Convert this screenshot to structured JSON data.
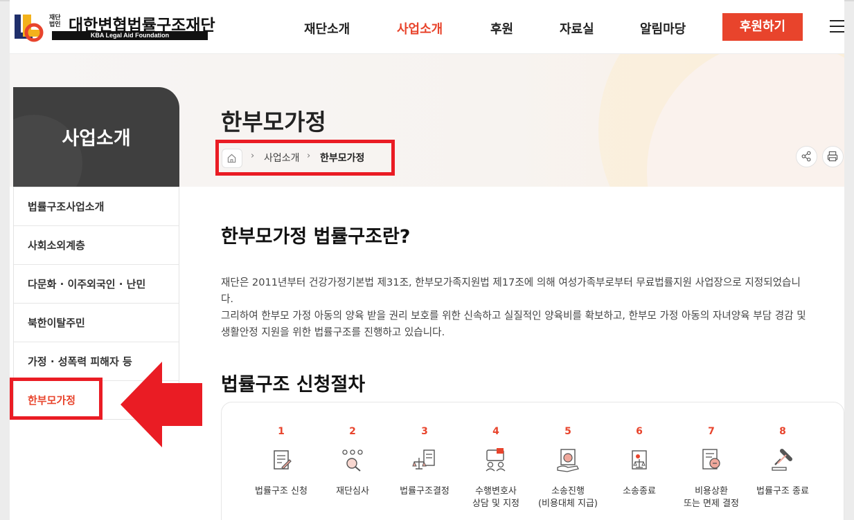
{
  "brand": {
    "sub_label": "재단법인",
    "name": "대한변협법률구조재단",
    "name_en": "KBA Legal Aid Foundation"
  },
  "nav": {
    "items": [
      {
        "label": "재단소개"
      },
      {
        "label": "사업소개",
        "active": true
      },
      {
        "label": "후원"
      },
      {
        "label": "자료실"
      },
      {
        "label": "알림마당"
      }
    ],
    "donate_label": "후원하기"
  },
  "sidebar": {
    "title": "사업소개",
    "items": [
      {
        "label": "법률구조사업소개"
      },
      {
        "label": "사회소외계층"
      },
      {
        "label": "다문화 · 이주외국인 · 난민"
      },
      {
        "label": "북한이탈주민"
      },
      {
        "label": "가정 · 성폭력 피해자 등"
      },
      {
        "label": "한부모가정",
        "active": true
      }
    ]
  },
  "page": {
    "title": "한부모가정",
    "breadcrumb": [
      "사업소개",
      "한부모가정"
    ]
  },
  "content": {
    "section1_title": "한부모가정 법률구조란?",
    "para_lines": [
      "재단은 2011년부터 건강가정기본법 제31조, 한부모가족지원법 제17조에 의해 여성가족부로부터 무료법률지원 사업장으로 지정되었습니",
      "다.",
      "그리하여 한부모 가정 아동의 양육 받을 권리 보호를 위한 신속하고 실질적인 양육비를 확보하고, 한부모 가정 아동의 자녀양육 부담 경감 및",
      "생활안정 지원을 위한 법률구조를 진행하고 있습니다."
    ],
    "section2_title": "법률구조 신청절차"
  },
  "steps": [
    {
      "num": "1",
      "line1": "법률구조 신청",
      "line2": "",
      "icon": "document-pen-icon"
    },
    {
      "num": "2",
      "line1": "재단심사",
      "line2": "",
      "icon": "review-search-icon"
    },
    {
      "num": "3",
      "line1": "법률구조결정",
      "line2": "",
      "icon": "scales-document-icon"
    },
    {
      "num": "4",
      "line1": "수행변호사",
      "line2": "상담 및 지정",
      "icon": "consultation-icon"
    },
    {
      "num": "5",
      "line1": "소송진행",
      "line2": "(비용대체 지급)",
      "icon": "payment-icon"
    },
    {
      "num": "6",
      "line1": "소송종료",
      "line2": "",
      "icon": "case-closed-icon"
    },
    {
      "num": "7",
      "line1": "비용상환",
      "line2": "또는 면제 결정",
      "icon": "reimbursement-icon"
    },
    {
      "num": "8",
      "line1": "법률구조 종료",
      "line2": "",
      "icon": "gavel-icon"
    }
  ],
  "colors": {
    "accent": "#e8442c",
    "annotation": "#ea1c24",
    "side_header": "#3f3f3f"
  }
}
